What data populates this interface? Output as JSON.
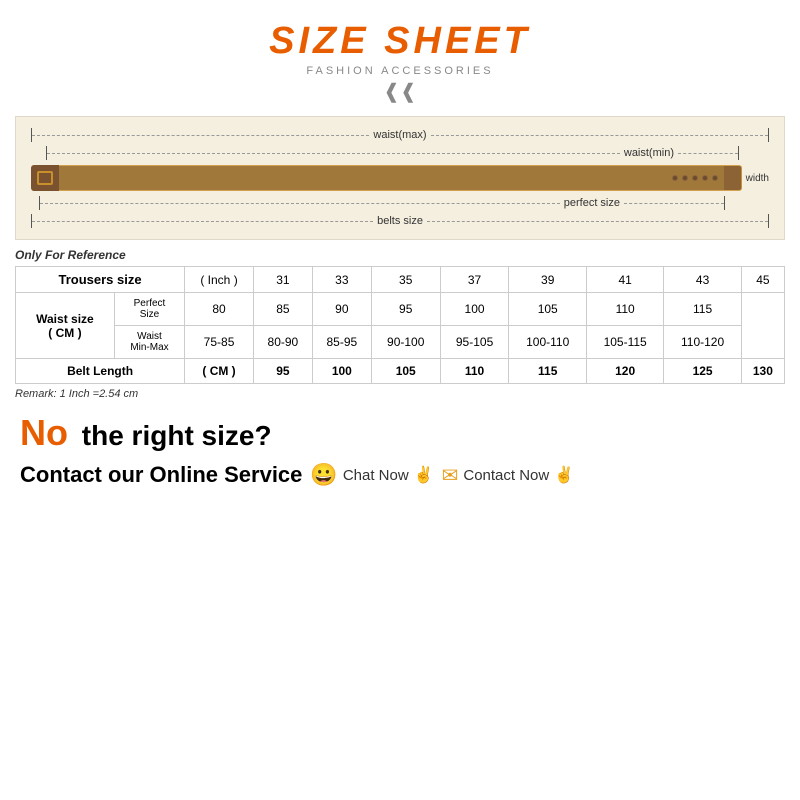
{
  "title": {
    "main": "SIZE SHEET",
    "sub": "FASHION ACCESSORIES",
    "chevrons": "❯❯"
  },
  "belt_diagram": {
    "waist_max": "waist(max)",
    "waist_min": "waist(min)",
    "perfect_size": "perfect size",
    "belts_size": "belts size",
    "width_label": "width"
  },
  "table": {
    "reference": "Only For Reference",
    "headers": [
      "Trousers size",
      "( Inch )",
      "31",
      "33",
      "35",
      "37",
      "39",
      "41",
      "43",
      "45"
    ],
    "waist_size_label": "Waist size\n( CM )",
    "perfect_size_label": "Perfect\nSize",
    "waist_min_max_label": "Waist\nMin-Max",
    "perfect_values": [
      "80",
      "85",
      "90",
      "95",
      "100",
      "105",
      "110",
      "115"
    ],
    "waist_values": [
      "75-85",
      "80-90",
      "85-95",
      "90-100",
      "95-105",
      "100-110",
      "105-115",
      "110-120"
    ],
    "belt_length_label": "Belt Length",
    "belt_length_unit": "( CM )",
    "belt_length_values": [
      "95",
      "100",
      "105",
      "110",
      "115",
      "120",
      "125",
      "130"
    ],
    "remark": "Remark: 1 Inch =2.54 cm"
  },
  "bottom": {
    "no_label": "No",
    "no_size_text": " the right size?",
    "contact_text": "Contact our Online Service",
    "chat_now": "Chat Now",
    "contact_now": "Contact Now"
  }
}
